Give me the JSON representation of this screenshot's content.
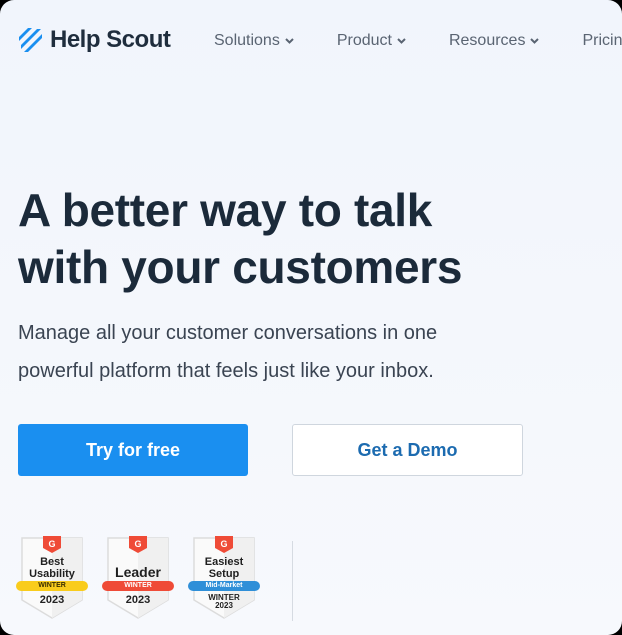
{
  "header": {
    "logo_text": "Help Scout",
    "logo_icon": "help-scout-stripes-icon",
    "brand_color": "#1a8ff0",
    "nav": [
      {
        "label": "Solutions",
        "has_dropdown": true
      },
      {
        "label": "Product",
        "has_dropdown": true
      },
      {
        "label": "Resources",
        "has_dropdown": true
      },
      {
        "label": "Pricing",
        "has_dropdown": false
      }
    ]
  },
  "hero": {
    "headline_line1": "A better way to talk",
    "headline_line2": "with your customers",
    "subtitle_line1": "Manage all your customer conversations in one",
    "subtitle_line2": "powerful platform that feels just like your inbox.",
    "primary_cta": "Try for free",
    "secondary_cta": "Get a Demo"
  },
  "badges": [
    {
      "title_line1": "Best",
      "title_line2": "Usability",
      "ribbon": "WINTER",
      "ribbon_color": "#f9cc1c",
      "ribbon_text_color": "#3a2e00",
      "year": "2023"
    },
    {
      "title_line1": "Leader",
      "title_line2": "",
      "ribbon": "WINTER",
      "ribbon_color": "#ef4b37",
      "ribbon_text_color": "#ffffff",
      "year": "2023"
    },
    {
      "title_line1": "Easiest",
      "title_line2": "Setup",
      "ribbon": "Mid-Market",
      "ribbon_color": "#2f8fd8",
      "ribbon_text_color": "#ffffff",
      "season": "WINTER",
      "year": "2023"
    }
  ],
  "badge_logo": "g2-logo-icon"
}
